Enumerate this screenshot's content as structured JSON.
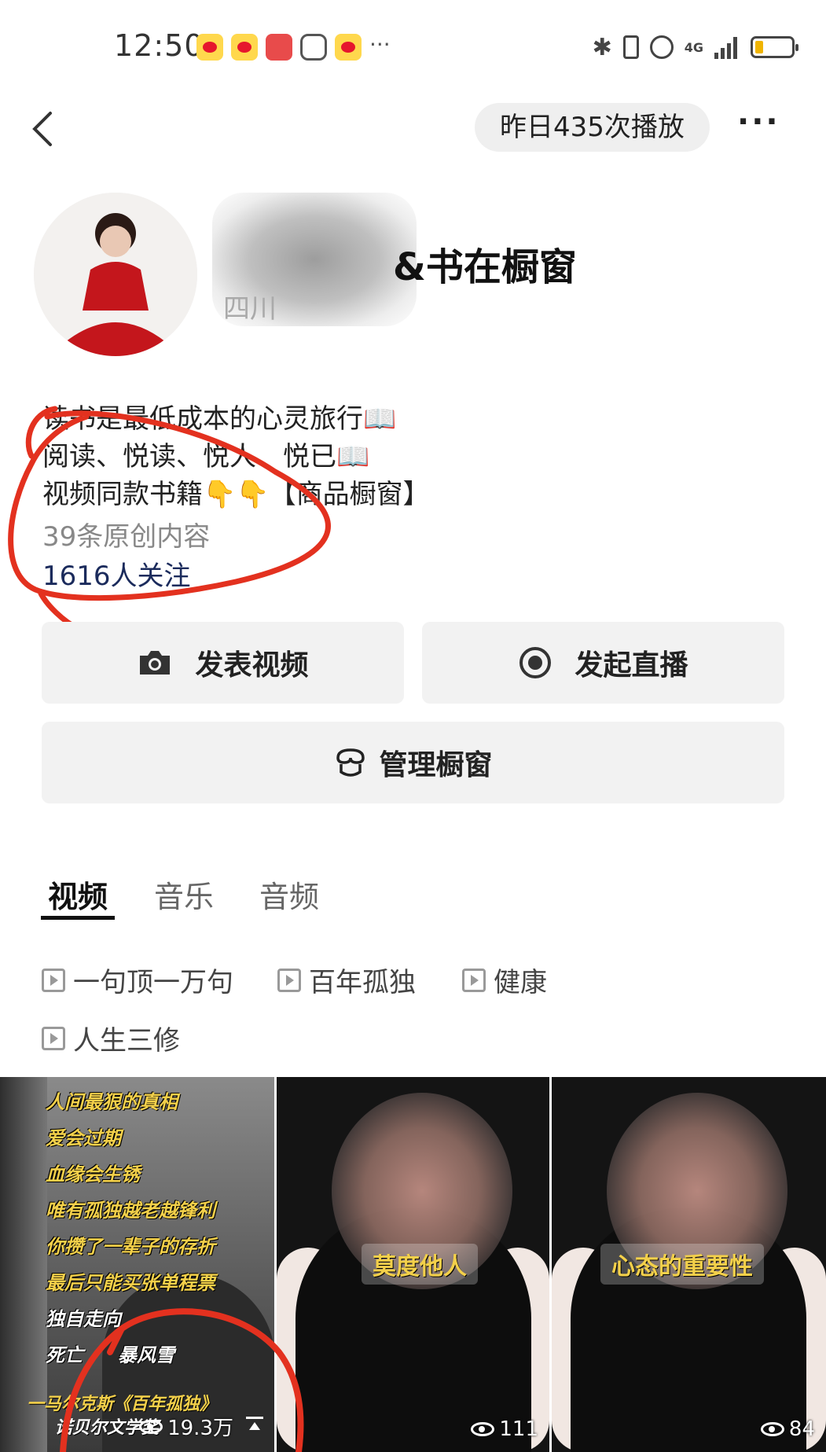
{
  "status_bar": {
    "time": "12:50",
    "network": "4G",
    "notification_icons": [
      "weibo-icon",
      "weibo-icon",
      "huawei-icon",
      "hexagon-icon",
      "weibo-icon"
    ],
    "more_indicator": "···"
  },
  "header": {
    "plays_yesterday": "昨日435次播放",
    "more": "···"
  },
  "profile": {
    "name": "&书在橱窗",
    "location": "四川",
    "bio": [
      "读书是最低成本的心灵旅行📖",
      "阅读、悦读、悦人、悦已📖",
      "视频同款书籍👇👇【商品橱窗】"
    ],
    "original_count": "39条原创内容",
    "followers": "1616人关注"
  },
  "actions": {
    "publish_video": "发表视频",
    "start_live": "发起直播",
    "manage_shop": "管理橱窗"
  },
  "tabs": [
    "视频",
    "音乐",
    "音频"
  ],
  "active_tab": "视频",
  "collections": [
    "一句顶一万句",
    "百年孤独",
    "健康",
    "人生三修"
  ],
  "videos": [
    {
      "lines": [
        "人间最狠的真相",
        "爱会过期",
        "血缘会生锈",
        "唯有孤独越老越锋利",
        "你攒了一辈子的存折",
        "最后只能买张单程票",
        "独自走向",
        "死亡",
        "暴风雪"
      ],
      "credit": "一马尔克斯《百年孤独》",
      "credit2": "诺贝尔文学奖",
      "views": "19.3万"
    },
    {
      "tag": "莫度他人",
      "views": "111"
    },
    {
      "tag": "心态的重要性",
      "views": "84"
    }
  ],
  "colors": {
    "annotation_red": "#e3311f",
    "follower_blue": "#1b2b5c",
    "button_bg": "#f2f2f2",
    "subtitle_yellow": "#f3d04a"
  }
}
